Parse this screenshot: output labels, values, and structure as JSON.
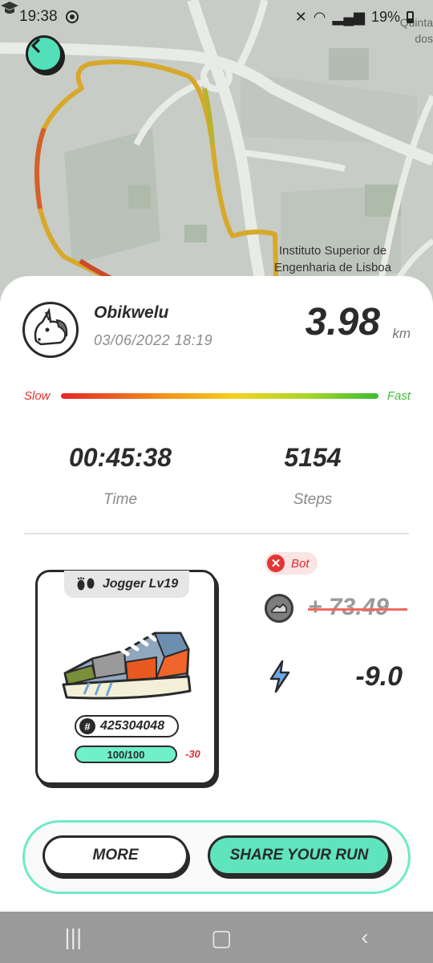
{
  "status_bar": {
    "time": "19:38",
    "battery": "19%"
  },
  "map": {
    "corner_text_line1": "Quinta",
    "corner_text_line2": "dos",
    "place_label_line1": "Instituto Superior de",
    "place_label_line2": "Engenharia de Lisboa",
    "back_icon": "chevron-left-icon"
  },
  "run": {
    "username": "Obikwelu",
    "datetime": "03/06/2022 18:19",
    "distance": "3.98",
    "distance_unit": "km",
    "speed_slow_label": "Slow",
    "speed_fast_label": "Fast",
    "time_value": "00:45:38",
    "time_label": "Time",
    "steps_value": "5154",
    "steps_label": "Steps"
  },
  "sneaker": {
    "class_level": "Jogger Lv19",
    "id": "425304048",
    "durability": "100/100",
    "durability_loss": "-30"
  },
  "rewards": {
    "bot_label": "Bot",
    "earned": "+ 73.49",
    "energy": "-9.0"
  },
  "buttons": {
    "more": "MORE",
    "share": "SHARE YOUR RUN"
  },
  "colors": {
    "accent_mint": "#5fe4bd",
    "slow_red": "#e03030",
    "fast_green": "#3fba3a"
  }
}
